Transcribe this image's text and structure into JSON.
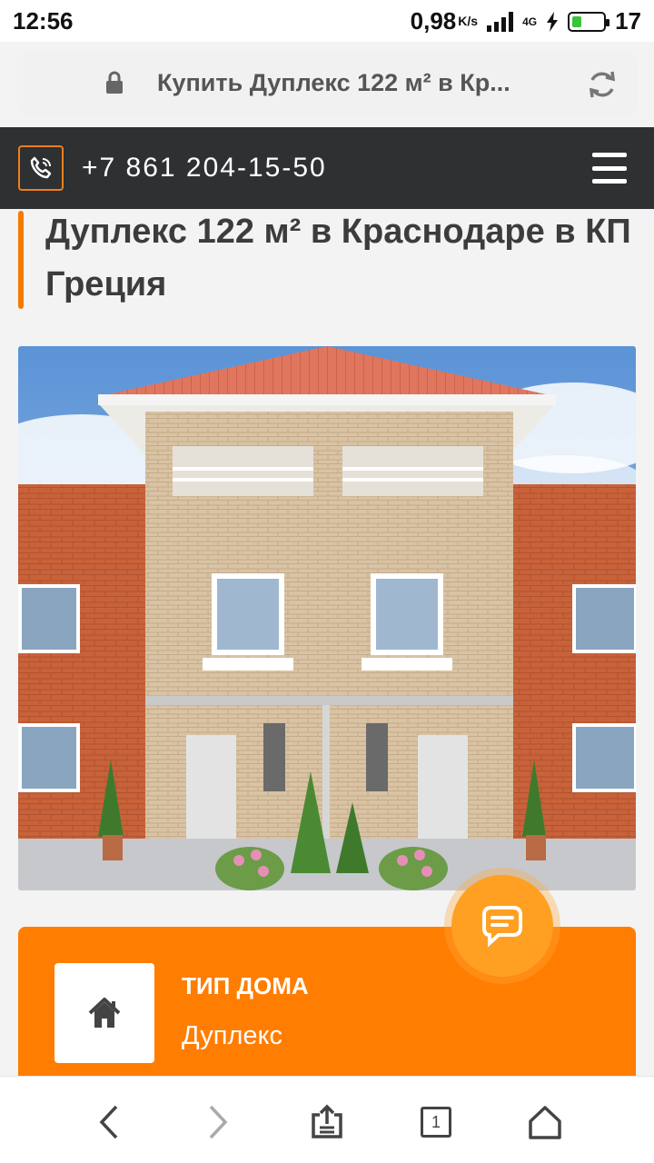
{
  "status_bar": {
    "time": "12:56",
    "speed": "0,98",
    "speed_unit": "K/s",
    "network": "4G",
    "battery": "17"
  },
  "browser": {
    "url_title": "Купить Дуплекс 122 м² в Кр..."
  },
  "header": {
    "phone": "+7 861 204-15-50"
  },
  "page": {
    "title": "Дуплекс 122 м² в Краснодаре в КП Греция"
  },
  "house_card": {
    "title": "ТИП ДОМА",
    "value": "Дуплекс"
  },
  "bottom_nav": {
    "tabs_count": "1"
  },
  "colors": {
    "accent": "#ff7d00",
    "header_bg": "#2e3032"
  }
}
